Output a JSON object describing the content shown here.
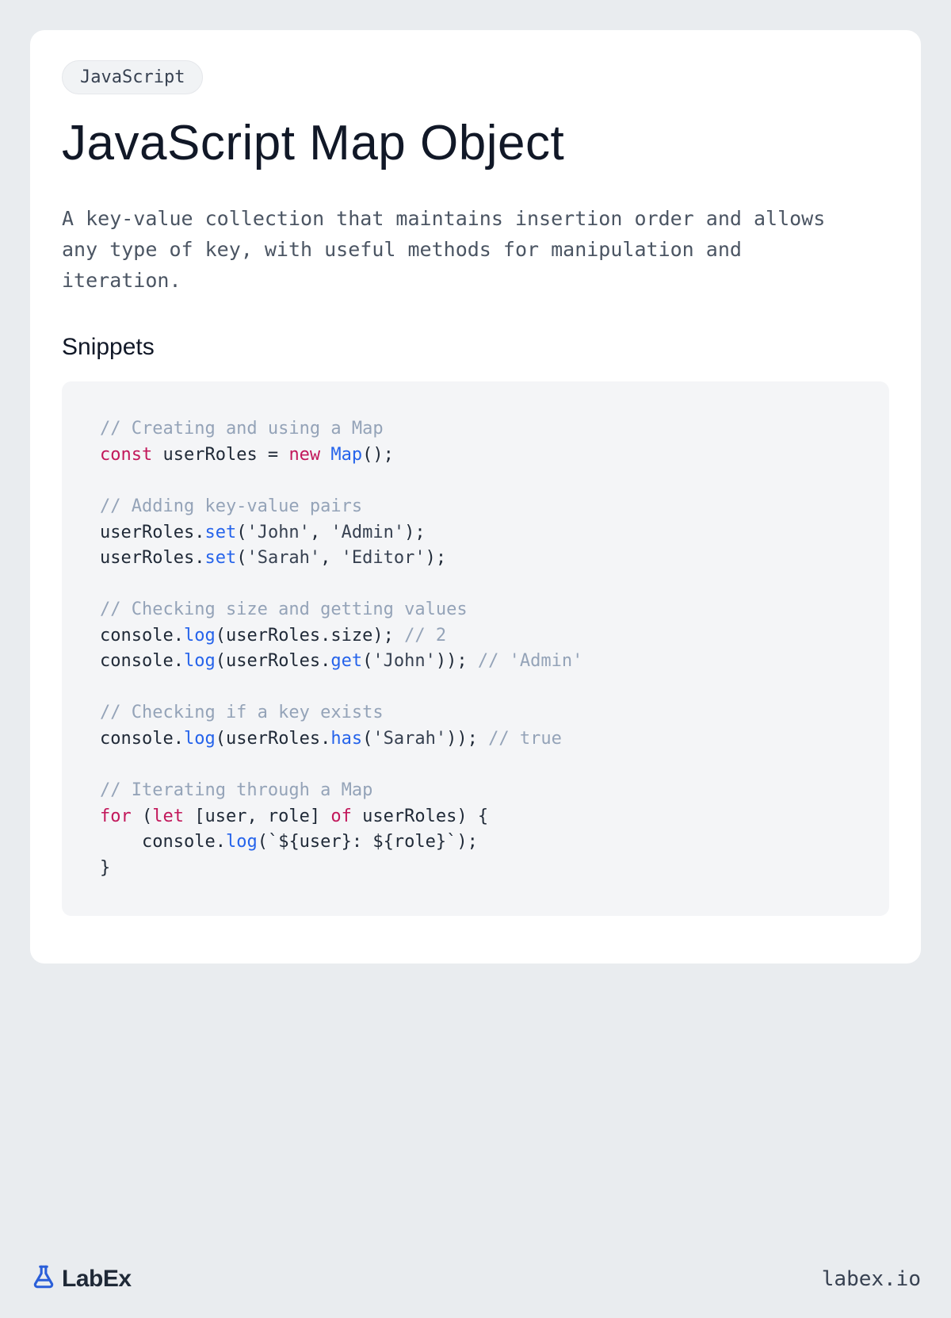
{
  "tag": "JavaScript",
  "title": "JavaScript Map Object",
  "description": "A key-value collection that maintains insertion order and allows any type of key, with useful methods for manipulation and iteration.",
  "section_heading": "Snippets",
  "code_tokens": [
    {
      "t": "// Creating and using a Map",
      "c": "tok-cm"
    },
    {
      "t": "\n"
    },
    {
      "t": "const ",
      "c": "tok-kw"
    },
    {
      "t": "userRoles = "
    },
    {
      "t": "new ",
      "c": "tok-kw"
    },
    {
      "t": "Map",
      "c": "tok-fn"
    },
    {
      "t": "();"
    },
    {
      "t": "\n"
    },
    {
      "t": "\n"
    },
    {
      "t": "// Adding key-value pairs",
      "c": "tok-cm"
    },
    {
      "t": "\n"
    },
    {
      "t": "userRoles."
    },
    {
      "t": "set",
      "c": "tok-fn"
    },
    {
      "t": "("
    },
    {
      "t": "'John'",
      "c": "tok-st"
    },
    {
      "t": ", "
    },
    {
      "t": "'Admin'",
      "c": "tok-st"
    },
    {
      "t": ");"
    },
    {
      "t": "\n"
    },
    {
      "t": "userRoles."
    },
    {
      "t": "set",
      "c": "tok-fn"
    },
    {
      "t": "("
    },
    {
      "t": "'Sarah'",
      "c": "tok-st"
    },
    {
      "t": ", "
    },
    {
      "t": "'Editor'",
      "c": "tok-st"
    },
    {
      "t": ");"
    },
    {
      "t": "\n"
    },
    {
      "t": "\n"
    },
    {
      "t": "// Checking size and getting values",
      "c": "tok-cm"
    },
    {
      "t": "\n"
    },
    {
      "t": "console."
    },
    {
      "t": "log",
      "c": "tok-fn"
    },
    {
      "t": "(userRoles.size); "
    },
    {
      "t": "// 2",
      "c": "tok-cm"
    },
    {
      "t": "\n"
    },
    {
      "t": "console."
    },
    {
      "t": "log",
      "c": "tok-fn"
    },
    {
      "t": "(userRoles."
    },
    {
      "t": "get",
      "c": "tok-fn"
    },
    {
      "t": "("
    },
    {
      "t": "'John'",
      "c": "tok-st"
    },
    {
      "t": ")); "
    },
    {
      "t": "// 'Admin'",
      "c": "tok-cm"
    },
    {
      "t": "\n"
    },
    {
      "t": "\n"
    },
    {
      "t": "// Checking if a key exists",
      "c": "tok-cm"
    },
    {
      "t": "\n"
    },
    {
      "t": "console."
    },
    {
      "t": "log",
      "c": "tok-fn"
    },
    {
      "t": "(userRoles."
    },
    {
      "t": "has",
      "c": "tok-fn"
    },
    {
      "t": "("
    },
    {
      "t": "'Sarah'",
      "c": "tok-st"
    },
    {
      "t": ")); "
    },
    {
      "t": "// true",
      "c": "tok-cm"
    },
    {
      "t": "\n"
    },
    {
      "t": "\n"
    },
    {
      "t": "// Iterating through a Map",
      "c": "tok-cm"
    },
    {
      "t": "\n"
    },
    {
      "t": "for ",
      "c": "tok-kw"
    },
    {
      "t": "("
    },
    {
      "t": "let ",
      "c": "tok-kw"
    },
    {
      "t": "[user, role] "
    },
    {
      "t": "of ",
      "c": "tok-kw"
    },
    {
      "t": "userRoles) {"
    },
    {
      "t": "\n"
    },
    {
      "t": "    console."
    },
    {
      "t": "log",
      "c": "tok-fn"
    },
    {
      "t": "(`${user}: ${role}`);"
    },
    {
      "t": "\n"
    },
    {
      "t": "}"
    }
  ],
  "footer": {
    "brand": "LabEx",
    "url": "labex.io"
  }
}
